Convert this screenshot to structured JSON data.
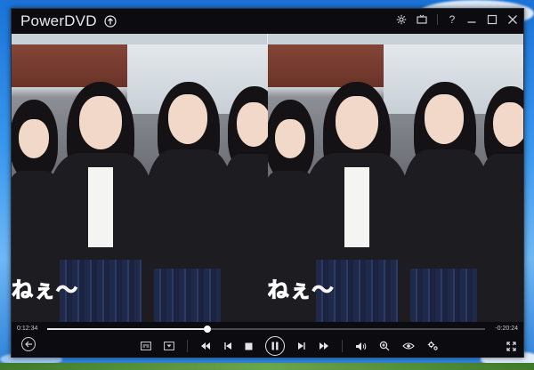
{
  "window": {
    "title": "PowerDVD",
    "title_buttons": [
      "settings-icon",
      "tv-mode-icon",
      "help",
      "minimize-icon",
      "maximize-icon",
      "close-icon"
    ],
    "help_label": "?"
  },
  "video": {
    "subtitle_left": "ねぇ〜",
    "subtitle_right": "ねぇ〜",
    "mode": "side-by-side comparison"
  },
  "playback": {
    "current_time": "0:12:34",
    "remaining_time": "-0:20:24",
    "progress": 0.366
  },
  "controls": {
    "left": [
      "back-icon"
    ],
    "center": [
      "subtitle-icon",
      "menu-icon",
      "rewind-icon",
      "previous-icon",
      "stop-icon",
      "pause-icon",
      "next-icon",
      "fast-forward-icon",
      "volume-icon",
      "zoom-icon",
      "eye-icon",
      "settings-icon"
    ],
    "right": [
      "fullscreen-icon"
    ]
  },
  "colors": {
    "window_bg": "#0b0b10",
    "text": "#e9e9ee",
    "subtitle_fill": "#ff4fa8",
    "accent": "#ffffff"
  }
}
